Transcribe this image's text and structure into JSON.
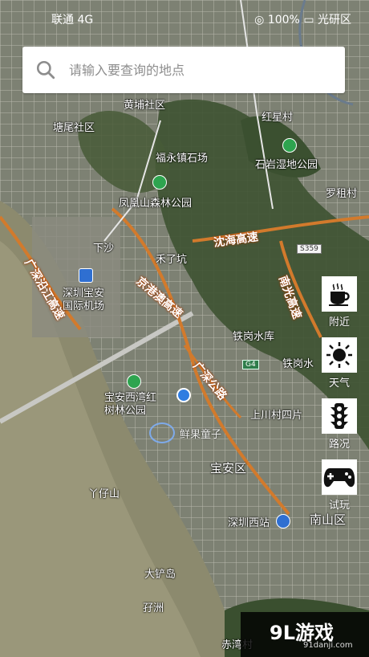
{
  "status_bar": {
    "left": "联通 4G",
    "battery": "100%",
    "right": "光研区"
  },
  "search": {
    "placeholder": "请输入要查询的地点"
  },
  "labels": {
    "huangpu": "黄埔社区",
    "tangwei": "塘尾社区",
    "hongxing": "红星村",
    "fuyong": "福永镇石场",
    "shiyan": "石岩湿地公园",
    "fenghuang": "凤凰山森林公园",
    "luozu": "罗租村",
    "xiasha": "下沙",
    "heliao": "禾了坑",
    "airport": "深圳宝安国际机场",
    "tiegang": "铁岗水库",
    "tiegang_short": "铁岗水",
    "baoan_park": "宝安西湾红树林公园",
    "shangchuan": "上川村四片",
    "baoan": "宝安区",
    "yazaishan": "丫仔山",
    "xixiang": "深圳西站",
    "nanshan": "南山区",
    "dachandao": "大铲岛",
    "xunzhou": "孖洲",
    "chiwan": "赤湾村",
    "brand": "鲜果童子"
  },
  "roads": {
    "yanhai": "沈海高速",
    "guanghui": "南光高速",
    "jinggang": "京港澳高速",
    "guangshen_yanjiang": "广深沿江高速",
    "guangshen": "广深公路"
  },
  "shields": {
    "s359": "S359",
    "g4": "G4"
  },
  "tools": [
    {
      "label": "附近",
      "icon": "coffee-cup-icon"
    },
    {
      "label": "天气",
      "icon": "sun-icon"
    },
    {
      "label": "路况",
      "icon": "traffic-light-icon"
    },
    {
      "label": "试玩",
      "icon": "gamepad-icon"
    }
  ],
  "watermark": {
    "logo": "9L游戏",
    "url": "91danji.com"
  }
}
